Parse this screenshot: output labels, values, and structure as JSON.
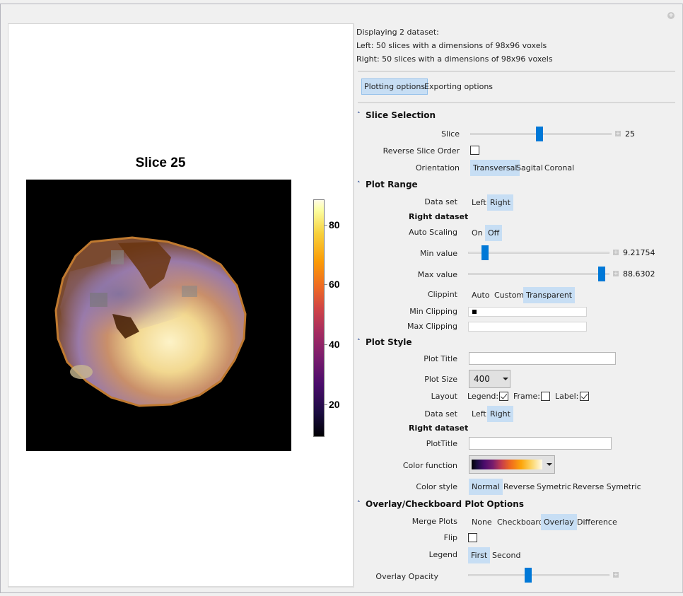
{
  "window": {
    "expand_icon": "plus-circle-icon"
  },
  "plot": {
    "title": "Slice 25",
    "colorbar": {
      "colormap": "inferno",
      "range": [
        9.21754,
        88.6302
      ],
      "tick_labels": [
        "80",
        "60",
        "40",
        "20"
      ],
      "tick_values": [
        80,
        60,
        40,
        20
      ]
    }
  },
  "info": {
    "line1": "Displaying 2 dataset:",
    "line2": "Left: 50 slices with a dimensions of 98x96 voxels",
    "line3": "Right: 50 slices with a dimensions of 98x96 voxels"
  },
  "tabs": [
    {
      "label": "Plotting options",
      "selected": true
    },
    {
      "label": "Exporting options",
      "selected": false
    }
  ],
  "slice_selection": {
    "header": "Slice Selection",
    "slice_label": "Slice",
    "slice_value": "25",
    "slice_fraction": 0.49,
    "reverse_label": "Reverse Slice Order",
    "reverse_checked": false,
    "orientation_label": "Orientation",
    "orientation_options": [
      "Transversal",
      "Sagital",
      "Coronal"
    ],
    "orientation_selected": "Transversal"
  },
  "plot_range": {
    "header": "Plot Range",
    "dataset_label": "Data set",
    "dataset_options": [
      "Left",
      "Right"
    ],
    "dataset_selected": "Right",
    "dataset_heading": "Right dataset",
    "autoscale_label": "Auto Scaling",
    "autoscale_options": [
      "On",
      "Off"
    ],
    "autoscale_selected": "Off",
    "min_label": "Min value",
    "min_value": "9.21754",
    "min_fraction": 0.1,
    "max_label": "Max value",
    "max_value": "88.6302",
    "max_fraction": 0.97,
    "clipping_label": "Clippint",
    "clipping_options": [
      "Auto",
      "Custom",
      "Transparent"
    ],
    "clipping_selected": "Transparent",
    "min_clip_label": "Min Clipping",
    "min_clip_color": "#000000",
    "max_clip_label": "Max Clipping",
    "max_clip_color": "#ffffff"
  },
  "plot_style": {
    "header": "Plot Style",
    "title_label": "Plot Title",
    "title_value": "",
    "size_label": "Plot Size",
    "size_value": "400",
    "layout_label": "Layout",
    "legend_label": "Legend:",
    "legend_checked": true,
    "frame_label": "Frame:",
    "frame_checked": false,
    "label_label": "Label:",
    "label_checked": true,
    "dataset_label": "Data set",
    "dataset_options": [
      "Left",
      "Right"
    ],
    "dataset_selected": "Right",
    "dataset_heading": "Right dataset",
    "plottitle_label": "PlotTitle",
    "plottitle_value": "",
    "color_function_label": "Color function",
    "color_function_value": "inferno",
    "color_style_label": "Color style",
    "color_style_options": [
      "Normal",
      "Reverse",
      "Symetric",
      "Reverse Symetric"
    ],
    "color_style_selected": "Normal"
  },
  "overlay": {
    "header": "Overlay/Checkboard Plot Options",
    "merge_label": "Merge Plots",
    "merge_options": [
      "None",
      "Checkboard",
      "Overlay",
      "Difference"
    ],
    "merge_selected": "Overlay",
    "flip_label": "Flip",
    "flip_checked": false,
    "legend_label": "Legend",
    "legend_options": [
      "First",
      "Second"
    ],
    "legend_selected": "First",
    "opacity_label": "Overlay Opacity",
    "opacity_fraction": 0.42
  },
  "colors": {
    "selected_bg": "#c7def4",
    "selected_border": "#93c0eb",
    "slider_thumb": "#0078d7",
    "section_caret": "#1a3c8c"
  }
}
